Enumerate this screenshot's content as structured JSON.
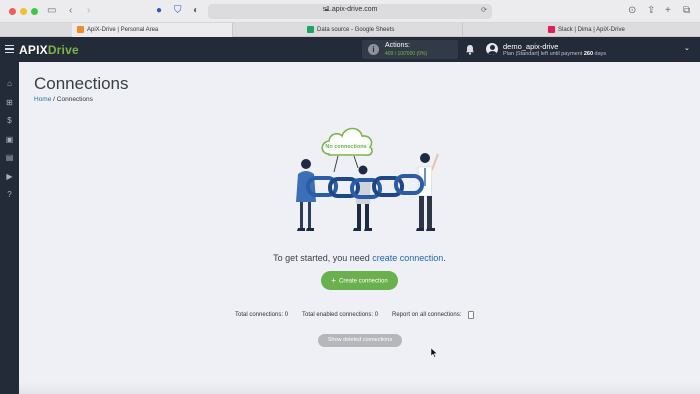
{
  "browser": {
    "url": "s1.apix-drive.com",
    "tabs": [
      {
        "label": "ApiX-Drive | Personal Area",
        "active": true
      },
      {
        "label": "Data source - Google Sheets",
        "active": false
      },
      {
        "label": "Slack | Dima | ApiX-Drive",
        "active": false
      }
    ]
  },
  "header": {
    "logo_left": "APIX",
    "logo_right": "Drive",
    "actions_label": "Actions:",
    "actions_count": "409 / 100'000 (0%)",
    "user_name": "demo_apix-drive",
    "user_plan_prefix": "Plan |Standart| left until payment",
    "user_plan_days": "260",
    "user_plan_suffix": "days"
  },
  "sidebar": {
    "icons": [
      "home-icon",
      "sitemap-icon",
      "dollar-icon",
      "briefcase-icon",
      "id-card-icon",
      "video-icon",
      "help-icon"
    ]
  },
  "main": {
    "title": "Connections",
    "breadcrumb_home": "Home",
    "breadcrumb_sep": "/",
    "breadcrumb_current": "Connections",
    "cloud_text": "No connections",
    "empty_prefix": "To get started, you need",
    "empty_link": "create connection",
    "empty_suffix": ".",
    "create_button": "Create connection",
    "total_connections": "Total connections: 0",
    "total_enabled": "Total enabled connections: 0",
    "report_label": "Report on all connections:",
    "show_deleted": "Show deleted connections"
  },
  "colors": {
    "header_bg": "#242b38",
    "accent_green": "#6ab04c",
    "link_blue": "#2466b3",
    "page_bg": "#eef0f5"
  }
}
